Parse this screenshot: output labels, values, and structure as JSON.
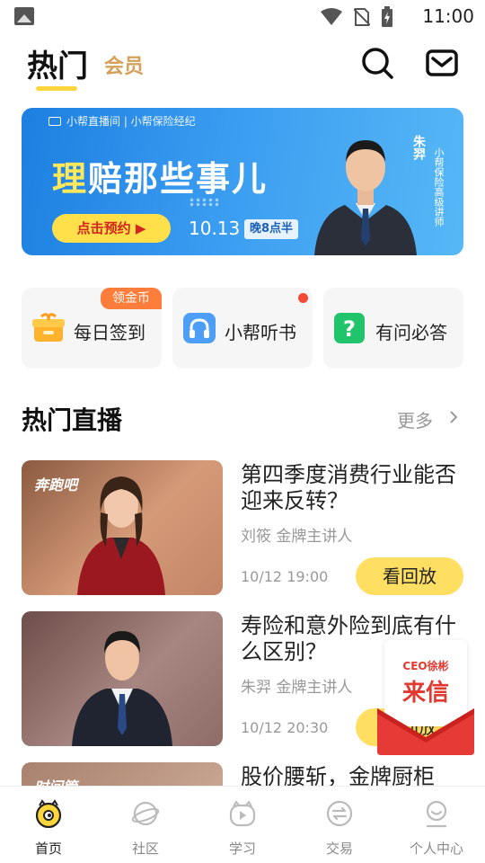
{
  "status_bar": {
    "time": "11:00",
    "icons": [
      "image-icon",
      "wifi-icon",
      "no-sim-icon",
      "battery-charging-icon"
    ]
  },
  "header": {
    "tabs": [
      {
        "label": "热门",
        "active": true
      },
      {
        "label": "会员",
        "active": false
      }
    ],
    "icons": [
      "search-icon",
      "mail-icon"
    ]
  },
  "banner": {
    "brand": "小帮直播间 | 小帮保险经纪",
    "title_highlight": "理",
    "title_rest": "赔那些事儿",
    "book_button": "点击预约 ▶",
    "date": "10.13",
    "time": "晚8点半",
    "presenter_name": "朱羿",
    "presenter_title": "小帮保险高级讲师"
  },
  "quick_entries": [
    {
      "label": "每日签到",
      "icon": "gift-icon",
      "tag": "领金币"
    },
    {
      "label": "小帮听书",
      "icon": "headphones-icon",
      "badge_dot": true
    },
    {
      "label": "有问必答",
      "icon": "question-icon"
    }
  ],
  "section": {
    "title": "热门直播",
    "more": "更多"
  },
  "live_items": [
    {
      "title": "第四季度消费行业能否迎来反转？",
      "speaker": "刘筱 金牌主讲人",
      "time": "10/12 19:00",
      "button": "看回放",
      "thumb_label": "奔跑吧"
    },
    {
      "title": "寿险和意外险到底有什么区别？",
      "speaker": "朱羿 金牌主讲人",
      "time": "10/12 20:30",
      "button": "看回放",
      "thumb_label": ""
    },
    {
      "title": "股价腰斩，金牌厨柜",
      "speaker": "",
      "time": "",
      "button": "",
      "thumb_label": "时间管"
    }
  ],
  "floating_letter": {
    "top": "CEO徐彬",
    "main": "来信"
  },
  "bottom_nav": [
    {
      "label": "首页",
      "icon": "home-face-icon",
      "active": true
    },
    {
      "label": "社区",
      "icon": "planet-icon",
      "active": false
    },
    {
      "label": "学习",
      "icon": "play-icon",
      "active": false
    },
    {
      "label": "交易",
      "icon": "exchange-icon",
      "active": false
    },
    {
      "label": "个人中心",
      "icon": "profile-icon",
      "active": false
    }
  ],
  "colors": {
    "accent_yellow": "#ffdf62",
    "banner_blue": "#2b8ae6",
    "vip_gold": "#d4a15a",
    "tag_orange": "#ff7d3a",
    "letter_red": "#e03a30"
  }
}
